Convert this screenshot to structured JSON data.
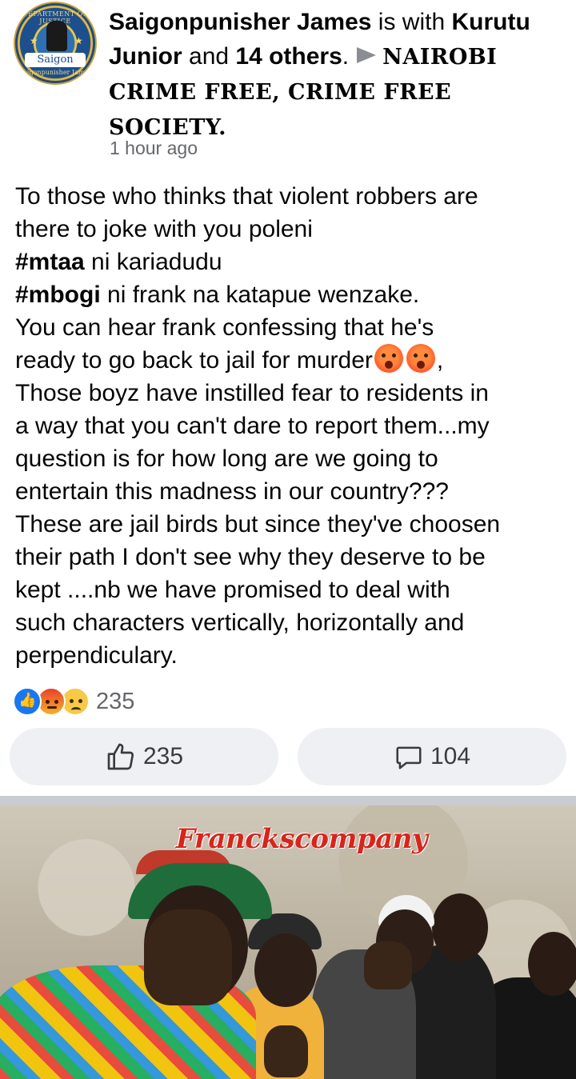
{
  "post": {
    "author": "Saigonpunisher James",
    "with_text": " is with ",
    "tagged_person": "Kurutu Junior",
    "and_text": " and ",
    "others": "14 others",
    "period": ".",
    "feeling_text": "NAIROBI CRIME FREE, CRIME FREE SOCIETY.",
    "timestamp": "1 hour ago",
    "avatar": {
      "seal_top": "DEPARTMENT OF JUSTICE",
      "ribbon": "Saigon",
      "seal_bottom": "Saigonpunisher James"
    },
    "body": {
      "line1": "To those who thinks that violent robbers are",
      "line2": "there to joke with you poleni",
      "tag1": "#mtaa",
      "tag1_rest": " ni kariadudu",
      "tag2": "#mbogi",
      "tag2_rest": " ni frank na katapue wenzake.",
      "line5": "You can hear frank confessing that he's",
      "line6": "ready to go back to jail for murder",
      "line6_end": ",",
      "line7": "Those boyz have instilled fear to residents in",
      "line8": "a way that you can't dare to report them...my",
      "line9": "question is for how long are we going to",
      "line10": "entertain this madness in our country???",
      "line11": "These are jail birds but since they've choosen",
      "line12": "their path I don't see why they deserve to be",
      "line13": "kept ....nb we have promised  to deal with",
      "line14": "such characters vertically, horizontally and",
      "line15": "perpendiculary."
    },
    "reactions": {
      "icons": [
        "like-reaction-icon",
        "angry-reaction-icon",
        "sad-reaction-icon"
      ],
      "count": "235"
    },
    "actions": {
      "like_count": "235",
      "comment_count": "104"
    },
    "photo": {
      "caption": "Franckscompany"
    }
  },
  "colors": {
    "like_blue": "#1877f2",
    "secondary_text": "#65676b",
    "button_bg": "#eff0f3",
    "caption_red": "#d8241c"
  }
}
